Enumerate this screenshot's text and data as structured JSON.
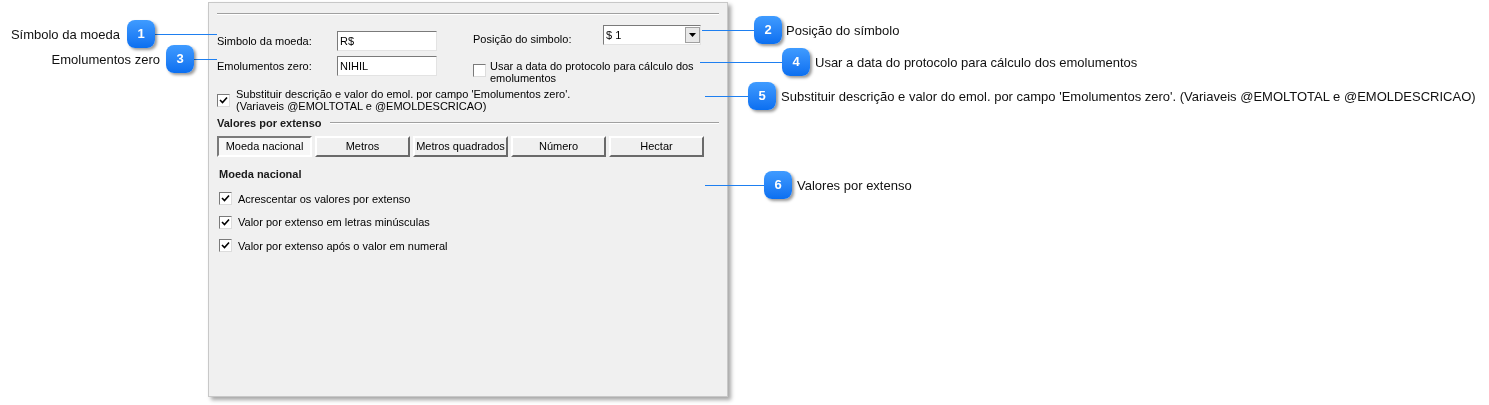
{
  "form": {
    "currency_symbol": {
      "label": "Simbolo da moeda:",
      "value": "R$"
    },
    "symbol_position": {
      "label": "Posição do simbolo:",
      "value": "$ 1"
    },
    "zero_fees": {
      "label": "Emolumentos zero:",
      "value": "NIHIL"
    },
    "use_protocol_date": {
      "lines": [
        "Usar a data do protocolo para cálculo dos",
        "emolumentos"
      ],
      "checked": false
    },
    "replace_description": {
      "lines": [
        "Substituir descrição e valor do emol. por campo 'Emolumentos zero'.",
        "(Variaveis @EMOLTOTAL e @EMOLDESCRICAO)"
      ],
      "checked": true
    }
  },
  "spelled_values": {
    "title": "Valores por extenso",
    "tabs": [
      {
        "label": "Moeda nacional",
        "selected": true
      },
      {
        "label": "Metros",
        "selected": false
      },
      {
        "label": "Metros quadrados",
        "selected": false
      },
      {
        "label": "Número",
        "selected": false
      },
      {
        "label": "Hectar",
        "selected": false
      }
    ],
    "subtitle": "Moeda nacional",
    "options": [
      {
        "label": "Acrescentar os valores por extenso",
        "checked": true
      },
      {
        "label": "Valor por extenso em letras minúsculas",
        "checked": true
      },
      {
        "label": "Valor por extenso após o valor em numeral",
        "checked": true
      }
    ]
  },
  "callouts": [
    {
      "number": "1",
      "label": "Símbolo da moeda"
    },
    {
      "number": "2",
      "label": "Posição do símbolo"
    },
    {
      "number": "3",
      "label": "Emolumentos zero"
    },
    {
      "number": "4",
      "label": "Usar a data do protocolo para cálculo dos emolumentos"
    },
    {
      "number": "5",
      "label": "Substituir descrição e valor do emol. por campo 'Emolumentos zero'. (Variaveis @EMOLTOTAL e @EMOLDESCRICAO)"
    },
    {
      "number": "6",
      "label": "Valores por extenso"
    }
  ]
}
